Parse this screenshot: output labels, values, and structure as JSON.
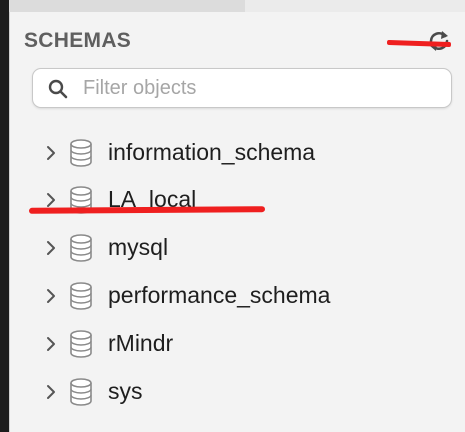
{
  "panel": {
    "title": "SCHEMAS",
    "refresh_icon": "refresh-arrows-icon"
  },
  "search": {
    "placeholder": "Filter objects",
    "value": "",
    "icon": "search-icon"
  },
  "schemas": [
    {
      "label": "information_schema",
      "icon": "database-icon",
      "expand_icon": "chevron-right-icon"
    },
    {
      "label": "LA_local",
      "icon": "database-icon",
      "expand_icon": "chevron-right-icon"
    },
    {
      "label": "mysql",
      "icon": "database-icon",
      "expand_icon": "chevron-right-icon"
    },
    {
      "label": "performance_schema",
      "icon": "database-icon",
      "expand_icon": "chevron-right-icon"
    },
    {
      "label": "rMindr",
      "icon": "database-icon",
      "expand_icon": "chevron-right-icon"
    },
    {
      "label": "sys",
      "icon": "database-icon",
      "expand_icon": "chevron-right-icon"
    }
  ],
  "colors": {
    "annotation": "#ef1f1f",
    "panel_background": "#f3f3f3",
    "header_text": "#5f5f5f",
    "placeholder_text": "#a6a6a6"
  }
}
